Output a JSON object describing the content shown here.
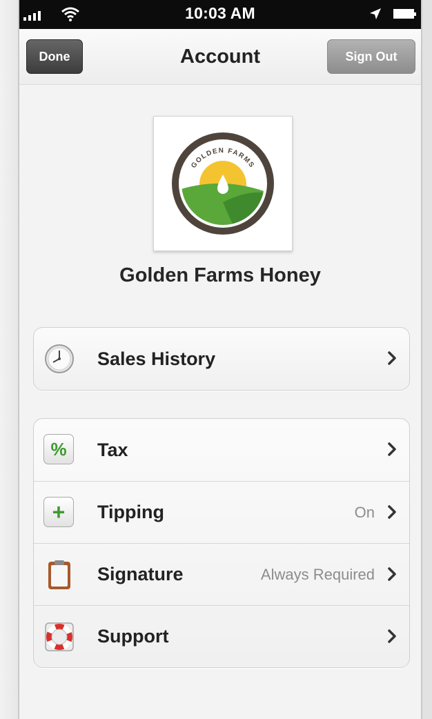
{
  "status_bar": {
    "time": "10:03 AM"
  },
  "nav": {
    "title": "Account",
    "done_label": "Done",
    "signout_label": "Sign Out"
  },
  "business": {
    "name": "Golden Farms Honey",
    "logo_text": "GOLDEN FARMS"
  },
  "history_group": [
    {
      "label": "Sales History",
      "value": "",
      "icon": "clock-icon"
    }
  ],
  "settings_group": [
    {
      "label": "Tax",
      "value": "",
      "icon": "percent-icon"
    },
    {
      "label": "Tipping",
      "value": "On",
      "icon": "plus-icon"
    },
    {
      "label": "Signature",
      "value": "Always Required",
      "icon": "clipboard-icon"
    },
    {
      "label": "Support",
      "value": "",
      "icon": "lifebuoy-icon"
    }
  ],
  "colors": {
    "status_bar": "#0c0c0c",
    "done_button": "#4a4a4a",
    "signout_button": "#a0a0a0",
    "logo_ring": "#4f443c",
    "logo_sun": "#f4c430",
    "logo_field": "#5aa83a",
    "icon_green": "#3e9b2e",
    "support_red": "#d9302a"
  }
}
